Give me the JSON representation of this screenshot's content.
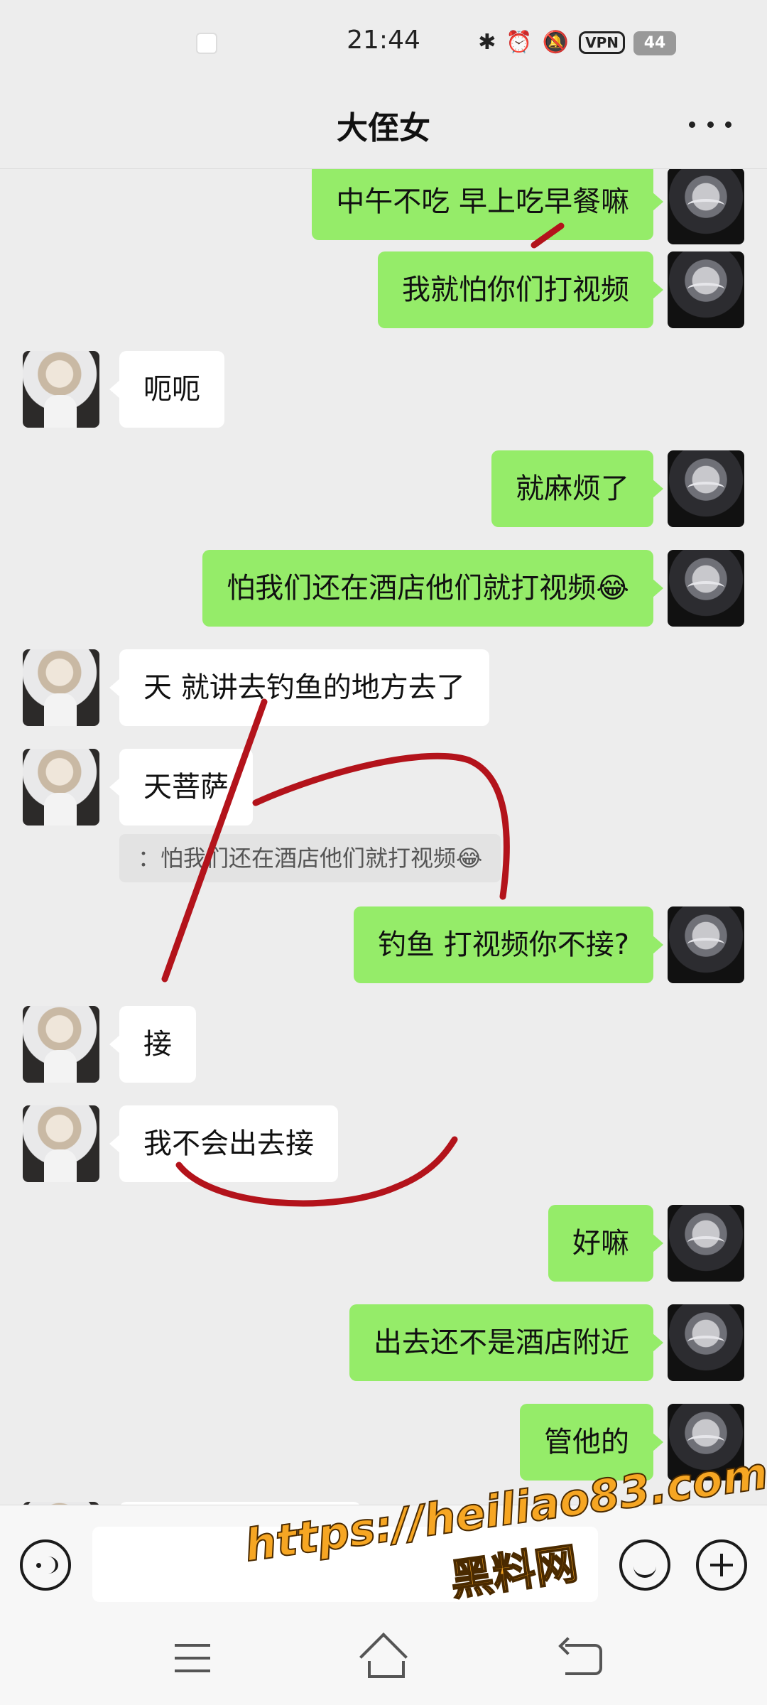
{
  "status_bar": {
    "time": "21:44",
    "vpn": "VPN",
    "battery": "44",
    "icons": [
      "bluetooth-icon",
      "alarm-icon",
      "mute-icon"
    ]
  },
  "header": {
    "title": "大侄女",
    "more_icon": "more-icon"
  },
  "messages": [
    {
      "from": "me",
      "text": "中午不吃 早上吃早餐嘛"
    },
    {
      "from": "me",
      "text": "我就怕你们打视频"
    },
    {
      "from": "them",
      "text": "呃呃"
    },
    {
      "from": "me",
      "text": "就麻烦了"
    },
    {
      "from": "me",
      "text": "怕我们还在酒店他们就打视频😂"
    },
    {
      "from": "them",
      "text": "天 就讲去钓鱼的地方去了"
    },
    {
      "from": "them",
      "text": "天菩萨"
    },
    {
      "from": "quote",
      "text": "：怕我们还在酒店他们就打视频😂"
    },
    {
      "from": "me",
      "text": "钓鱼 打视频你不接?"
    },
    {
      "from": "them",
      "text": "接"
    },
    {
      "from": "them",
      "text": "我不会出去接"
    },
    {
      "from": "me",
      "text": "好嘛"
    },
    {
      "from": "me",
      "text": "出去还不是酒店附近"
    },
    {
      "from": "me",
      "text": "管他的"
    }
  ],
  "input_bar": {
    "placeholder": "",
    "voice_icon": "voice-icon",
    "emoji_icon": "emoji-icon",
    "plus_icon": "plus-icon"
  },
  "watermark": {
    "url": "https://heiliao83.com",
    "site": "黑料网"
  },
  "colors": {
    "background": "#ededed",
    "my_bubble": "#95ec69",
    "their_bubble": "#ffffff",
    "annotation": "#b3131b",
    "watermark": "#f6a623"
  }
}
